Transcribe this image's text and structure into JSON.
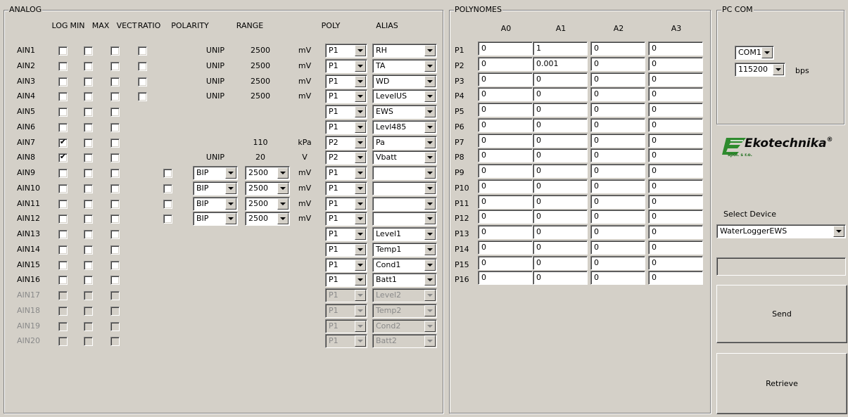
{
  "analog": {
    "title": "ANALOG",
    "headers": [
      "LOG",
      "MIN",
      "MAX",
      "VECT",
      "RATIO",
      "POLARITY",
      "RANGE",
      "POLY",
      "ALIAS"
    ],
    "rows": [
      {
        "name": "AIN1",
        "log": false,
        "min": false,
        "max": false,
        "vect": false,
        "ratio": null,
        "polarity": "UNIP",
        "polarity_dd": false,
        "range": "2500",
        "range_dd": false,
        "unit": "mV",
        "poly": "P1",
        "alias": "RH",
        "enabled": true
      },
      {
        "name": "AIN2",
        "log": false,
        "min": false,
        "max": false,
        "vect": false,
        "ratio": null,
        "polarity": "UNIP",
        "polarity_dd": false,
        "range": "2500",
        "range_dd": false,
        "unit": "mV",
        "poly": "P1",
        "alias": "TA",
        "enabled": true
      },
      {
        "name": "AIN3",
        "log": false,
        "min": false,
        "max": false,
        "vect": false,
        "ratio": null,
        "polarity": "UNIP",
        "polarity_dd": false,
        "range": "2500",
        "range_dd": false,
        "unit": "mV",
        "poly": "P1",
        "alias": "WD",
        "enabled": true
      },
      {
        "name": "AIN4",
        "log": false,
        "min": false,
        "max": false,
        "vect": false,
        "ratio": null,
        "polarity": "UNIP",
        "polarity_dd": false,
        "range": "2500",
        "range_dd": false,
        "unit": "mV",
        "poly": "P1",
        "alias": "LevelUS",
        "enabled": true
      },
      {
        "name": "AIN5",
        "log": false,
        "min": false,
        "max": false,
        "vect": null,
        "ratio": null,
        "polarity": "",
        "polarity_dd": false,
        "range": "",
        "range_dd": false,
        "unit": "",
        "poly": "P1",
        "alias": "EWS",
        "enabled": true
      },
      {
        "name": "AIN6",
        "log": false,
        "min": false,
        "max": false,
        "vect": null,
        "ratio": null,
        "polarity": "",
        "polarity_dd": false,
        "range": "",
        "range_dd": false,
        "unit": "",
        "poly": "P1",
        "alias": "Levl485",
        "enabled": true
      },
      {
        "name": "AIN7",
        "log": true,
        "min": false,
        "max": false,
        "vect": null,
        "ratio": null,
        "polarity": "",
        "polarity_dd": false,
        "range": "110",
        "range_dd": false,
        "unit": "kPa",
        "poly": "P2",
        "alias": "Pa",
        "enabled": true
      },
      {
        "name": "AIN8",
        "log": true,
        "min": false,
        "max": false,
        "vect": null,
        "ratio": null,
        "polarity": "UNIP",
        "polarity_dd": false,
        "range": "20",
        "range_dd": false,
        "unit": "V",
        "poly": "P2",
        "alias": "Vbatt",
        "enabled": true
      },
      {
        "name": "AIN9",
        "log": false,
        "min": false,
        "max": false,
        "vect": null,
        "ratio": false,
        "polarity": "BIP",
        "polarity_dd": true,
        "range": "2500",
        "range_dd": true,
        "unit": "mV",
        "poly": "P1",
        "alias": "",
        "enabled": true
      },
      {
        "name": "AIN10",
        "log": false,
        "min": false,
        "max": false,
        "vect": null,
        "ratio": false,
        "polarity": "BIP",
        "polarity_dd": true,
        "range": "2500",
        "range_dd": true,
        "unit": "mV",
        "poly": "P1",
        "alias": "",
        "enabled": true
      },
      {
        "name": "AIN11",
        "log": false,
        "min": false,
        "max": false,
        "vect": null,
        "ratio": false,
        "polarity": "BIP",
        "polarity_dd": true,
        "range": "2500",
        "range_dd": true,
        "unit": "mV",
        "poly": "P1",
        "alias": "",
        "enabled": true
      },
      {
        "name": "AIN12",
        "log": false,
        "min": false,
        "max": false,
        "vect": null,
        "ratio": false,
        "polarity": "BIP",
        "polarity_dd": true,
        "range": "2500",
        "range_dd": true,
        "unit": "mV",
        "poly": "P1",
        "alias": "",
        "enabled": true
      },
      {
        "name": "AIN13",
        "log": false,
        "min": false,
        "max": false,
        "vect": null,
        "ratio": null,
        "polarity": "",
        "polarity_dd": false,
        "range": "",
        "range_dd": false,
        "unit": "",
        "poly": "P1",
        "alias": "Level1",
        "enabled": true
      },
      {
        "name": "AIN14",
        "log": false,
        "min": false,
        "max": false,
        "vect": null,
        "ratio": null,
        "polarity": "",
        "polarity_dd": false,
        "range": "",
        "range_dd": false,
        "unit": "",
        "poly": "P1",
        "alias": "Temp1",
        "enabled": true
      },
      {
        "name": "AIN15",
        "log": false,
        "min": false,
        "max": false,
        "vect": null,
        "ratio": null,
        "polarity": "",
        "polarity_dd": false,
        "range": "",
        "range_dd": false,
        "unit": "",
        "poly": "P1",
        "alias": "Cond1",
        "enabled": true
      },
      {
        "name": "AIN16",
        "log": false,
        "min": false,
        "max": false,
        "vect": null,
        "ratio": null,
        "polarity": "",
        "polarity_dd": false,
        "range": "",
        "range_dd": false,
        "unit": "",
        "poly": "P1",
        "alias": "Batt1",
        "enabled": true
      },
      {
        "name": "AIN17",
        "log": false,
        "min": false,
        "max": false,
        "vect": null,
        "ratio": null,
        "polarity": "",
        "polarity_dd": false,
        "range": "",
        "range_dd": false,
        "unit": "",
        "poly": "P1",
        "alias": "Level2",
        "enabled": false
      },
      {
        "name": "AIN18",
        "log": false,
        "min": false,
        "max": false,
        "vect": null,
        "ratio": null,
        "polarity": "",
        "polarity_dd": false,
        "range": "",
        "range_dd": false,
        "unit": "",
        "poly": "P1",
        "alias": "Temp2",
        "enabled": false
      },
      {
        "name": "AIN19",
        "log": false,
        "min": false,
        "max": false,
        "vect": null,
        "ratio": null,
        "polarity": "",
        "polarity_dd": false,
        "range": "",
        "range_dd": false,
        "unit": "",
        "poly": "P1",
        "alias": "Cond2",
        "enabled": false
      },
      {
        "name": "AIN20",
        "log": false,
        "min": false,
        "max": false,
        "vect": null,
        "ratio": null,
        "polarity": "",
        "polarity_dd": false,
        "range": "",
        "range_dd": false,
        "unit": "",
        "poly": "P1",
        "alias": "Batt2",
        "enabled": false
      }
    ]
  },
  "polynomes": {
    "title": "POLYNOMES",
    "headers": [
      "A0",
      "A1",
      "A2",
      "A3"
    ],
    "rows": [
      {
        "name": "P1",
        "values": [
          "0",
          "1",
          "0",
          "0"
        ]
      },
      {
        "name": "P2",
        "values": [
          "0",
          "0.001",
          "0",
          "0"
        ]
      },
      {
        "name": "P3",
        "values": [
          "0",
          "0",
          "0",
          "0"
        ]
      },
      {
        "name": "P4",
        "values": [
          "0",
          "0",
          "0",
          "0"
        ]
      },
      {
        "name": "P5",
        "values": [
          "0",
          "0",
          "0",
          "0"
        ]
      },
      {
        "name": "P6",
        "values": [
          "0",
          "0",
          "0",
          "0"
        ]
      },
      {
        "name": "P7",
        "values": [
          "0",
          "0",
          "0",
          "0"
        ]
      },
      {
        "name": "P8",
        "values": [
          "0",
          "0",
          "0",
          "0"
        ]
      },
      {
        "name": "P9",
        "values": [
          "0",
          "0",
          "0",
          "0"
        ]
      },
      {
        "name": "P10",
        "values": [
          "0",
          "0",
          "0",
          "0"
        ]
      },
      {
        "name": "P11",
        "values": [
          "0",
          "0",
          "0",
          "0"
        ]
      },
      {
        "name": "P12",
        "values": [
          "0",
          "0",
          "0",
          "0"
        ]
      },
      {
        "name": "P13",
        "values": [
          "0",
          "0",
          "0",
          "0"
        ]
      },
      {
        "name": "P14",
        "values": [
          "0",
          "0",
          "0",
          "0"
        ]
      },
      {
        "name": "P15",
        "values": [
          "0",
          "0",
          "0",
          "0"
        ]
      },
      {
        "name": "P16",
        "values": [
          "0",
          "0",
          "0",
          "0"
        ]
      }
    ]
  },
  "pc_com": {
    "title": "PC COM",
    "port": "COM1",
    "baud": "115200",
    "baud_unit": "bps"
  },
  "logo": {
    "text": "Ekotechnika",
    "registered": "®",
    "tagline": "spol. s r.o."
  },
  "device": {
    "label": "Select Device",
    "selected": "WaterLoggerEWS",
    "status": ""
  },
  "buttons": {
    "send": "Send",
    "retrieve": "Retrieve"
  },
  "colors": {
    "window_bg": "#d4d0c8",
    "logo_green": "#2e8b2e"
  }
}
